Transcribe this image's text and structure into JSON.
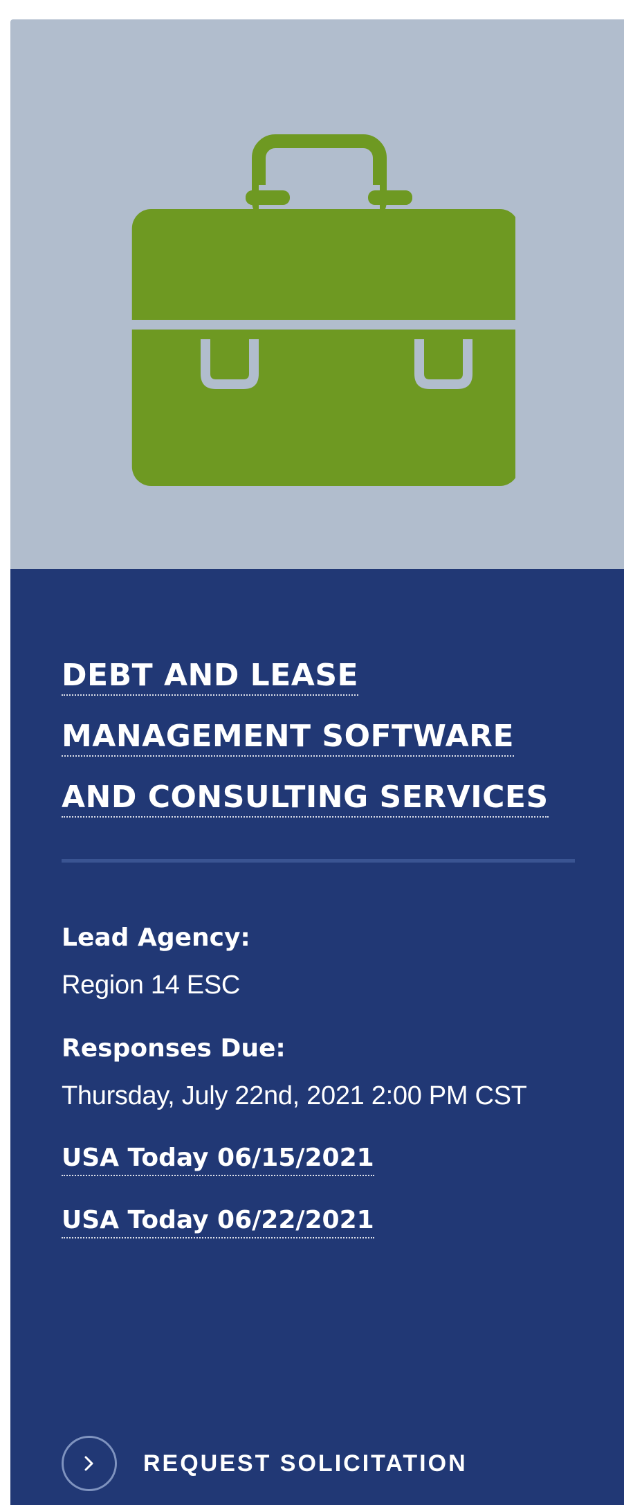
{
  "card": {
    "icon": "briefcase-icon",
    "icon_color": "#6e9922",
    "hero_background": "#b1bdcd",
    "body_background": "#213875",
    "title_lines": [
      "DEBT AND LEASE",
      "MANAGEMENT SOFTWARE",
      "AND CONSULTING SERVICES"
    ],
    "lead_agency": {
      "label": "Lead Agency:",
      "value": "Region 14 ESC"
    },
    "responses_due": {
      "label": "Responses Due:",
      "value": "Thursday, July 22nd, 2021 2:00 PM CST"
    },
    "documents": [
      "USA Today 06/15/2021",
      "USA Today 06/22/2021"
    ],
    "cta": {
      "label": "REQUEST SOLICITATION",
      "icon": "chevron-right-icon"
    }
  }
}
